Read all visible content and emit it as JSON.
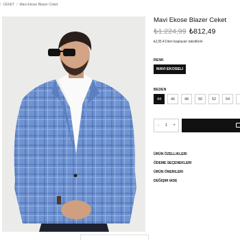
{
  "breadcrumb": {
    "items": [
      "CEKET",
      "Mavi Ekose Blazer Ceket"
    ],
    "separator": "/"
  },
  "product": {
    "title": "Mavi Ekose Blazer Ceket",
    "old_price": "₺1.224,99",
    "new_price": "₺812,49",
    "installment_text": "₺135,41'den başlayan taksitlerle",
    "image_alt": "Mavi ekose blazer ceket giyen model"
  },
  "color": {
    "label": "RENK",
    "selected": "MAVI EKOSELI"
  },
  "size": {
    "label": "BEDEN",
    "options": [
      "44",
      "46",
      "48",
      "50",
      "52",
      "54",
      ""
    ],
    "selected": "44"
  },
  "quantity": {
    "minus": "-",
    "value": "1",
    "plus": "+"
  },
  "cart": {
    "icon": "cart-icon"
  },
  "links": {
    "features": "ÜRÜN ÖZELLIKLERI",
    "payment": "ÖDEME SEÇENEKLERI",
    "suggestions": "ÜRÜN ÖNERILERI",
    "returns": "DEĞIŞIM IADE"
  },
  "colors": {
    "accent": "#111111",
    "jacket": "#6a8fd0",
    "old_price": "#999999"
  }
}
